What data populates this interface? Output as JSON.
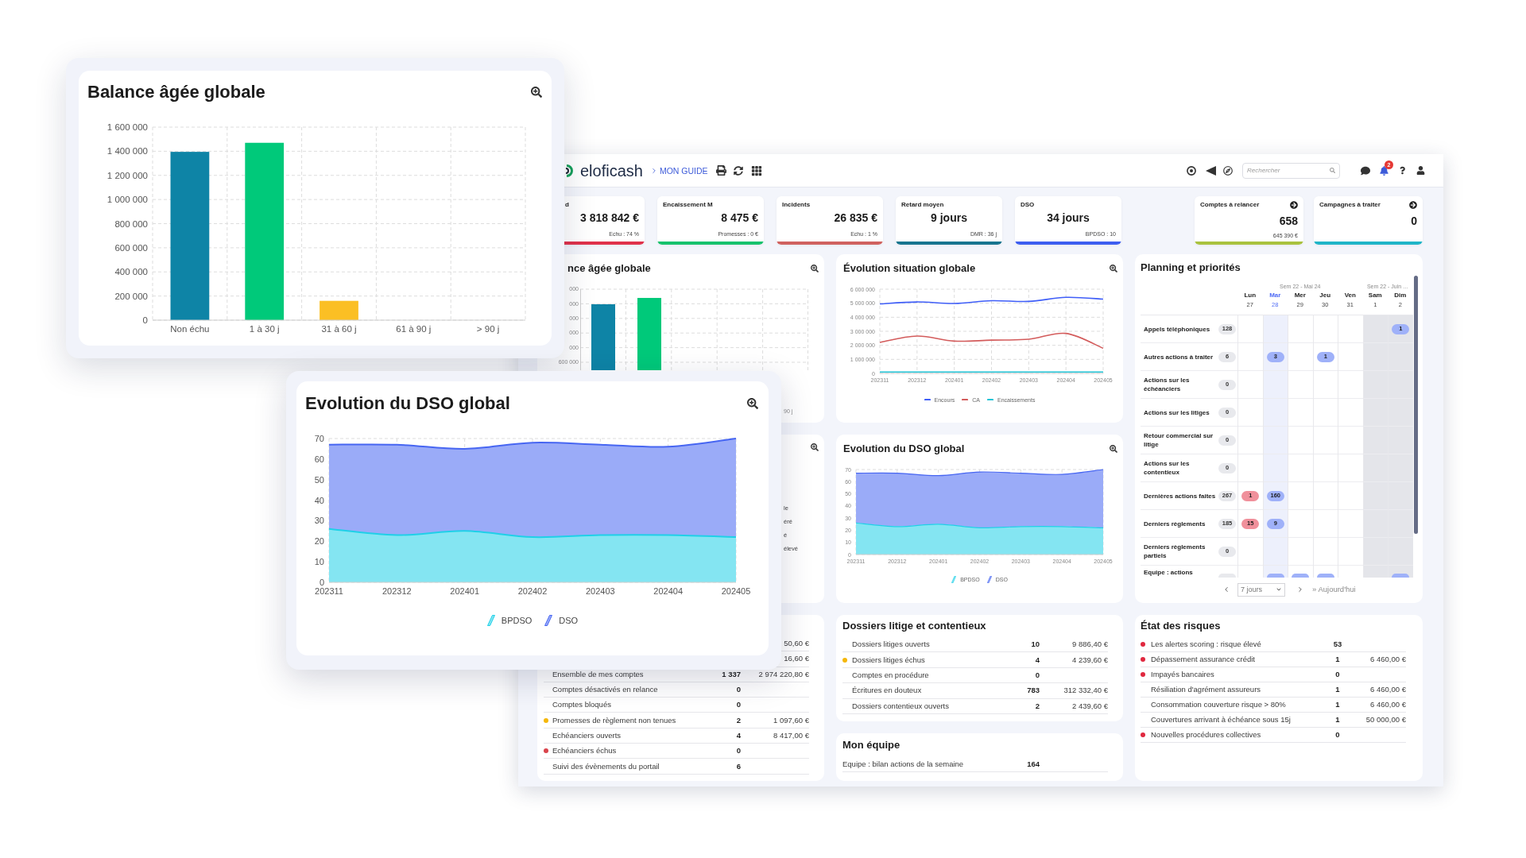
{
  "overlay_cards": [
    {
      "title": "Balance âgée globale",
      "chart_data": {
        "type": "bar",
        "categories": [
          "Non échu",
          "1 à 30 j",
          "31 à 60 j",
          "61 à 90 j",
          "> 90 j"
        ],
        "values": [
          1395000,
          1470000,
          160000,
          0,
          0
        ],
        "colors": [
          "#0e84a6",
          "#00c97a",
          "#fbbf24",
          null,
          null
        ],
        "grid": true,
        "ylim": [
          0,
          1600000
        ],
        "yticks": [
          {
            "value": 0,
            "label": "0"
          },
          {
            "value": 200000,
            "label": "200 000"
          },
          {
            "value": 400000,
            "label": "400 000"
          },
          {
            "value": 600000,
            "label": "600 000"
          },
          {
            "value": 800000,
            "label": "800 000"
          },
          {
            "value": 1000000,
            "label": "1 000 000"
          },
          {
            "value": 1200000,
            "label": "1 200 000"
          },
          {
            "value": 1400000,
            "label": "1 400 000"
          },
          {
            "value": 1600000,
            "label": "1 600 000"
          }
        ]
      }
    },
    {
      "title": "Evolution du DSO global",
      "chart_data": {
        "type": "area",
        "x": [
          "202311",
          "202312",
          "202401",
          "202402",
          "202403",
          "202404",
          "202405"
        ],
        "series": [
          {
            "name": "BPDSO",
            "color": "#1fd0e8",
            "values": [
              26,
              23,
              25,
              22,
              23,
              23,
              22
            ]
          },
          {
            "name": "DSO",
            "color": "#4766f2",
            "values": [
              67,
              67,
              65,
              68,
              67,
              66,
              70
            ]
          }
        ],
        "grid": true,
        "legend": "bottom",
        "ylim": [
          0,
          70
        ],
        "yticks": [
          0,
          10,
          20,
          30,
          40,
          50,
          60,
          70
        ]
      }
    }
  ],
  "dashboard": {
    "header": {
      "logo": "eloficash",
      "guide_link": "MON GUIDE",
      "search": {
        "placeholder": "Rechercher"
      },
      "notification_count": "2"
    },
    "kpis": [
      {
        "label": "d",
        "value": "3 818 842 €",
        "note": "Echu : 74 %",
        "kind": "amount",
        "color": "#e0324b"
      },
      {
        "label": "Encaissement M",
        "value": "8 475 €",
        "note": "Promesses : 0 €",
        "kind": "amount",
        "color": "#18c26d"
      },
      {
        "label": "Incidents",
        "value": "26 835 €",
        "note": "Echu : 1 %",
        "kind": "amount",
        "color": "#d0625f"
      },
      {
        "label": "Retard moyen",
        "value": "9 jours",
        "note": "DMR : 36 j",
        "kind": "duration",
        "color": "#18758f"
      },
      {
        "label": "DSO",
        "value": "34 jours",
        "note": "BPDSO : 10",
        "kind": "duration",
        "color": "#3d5ef0"
      },
      {
        "label": "Comptes à relancer",
        "value": "658",
        "note": "645 390 €",
        "kind": "counter",
        "color": "#a9c23f"
      },
      {
        "label": "Campagnes à traiter",
        "value": "0",
        "kind": "counter",
        "color": "#20b5c8"
      }
    ],
    "partial_balance_card": {
      "title": "nce âgée globale",
      "y_tick_fragments": [
        "000",
        "000",
        "000",
        "000",
        "000",
        "600 000"
      ],
      "x_label_fragment": "90 j"
    },
    "situation_card": {
      "title": "Évolution situation globale",
      "chart_data": {
        "type": "line",
        "x": [
          "202311",
          "202312",
          "202401",
          "202402",
          "202403",
          "202404",
          "202405"
        ],
        "series": [
          {
            "name": "Encours",
            "color": "#3f5ef8",
            "values": [
              4950000,
              5090000,
              4980000,
              5180000,
              5130000,
              5420000,
              5290000
            ]
          },
          {
            "name": "CA",
            "color": "#d35b5b",
            "values": [
              2210000,
              2660000,
              2300000,
              2370000,
              2430000,
              2850000,
              1790000
            ]
          },
          {
            "name": "Encaissements",
            "color": "#22c4d6",
            "values": [
              100000,
              100000,
              100000,
              100000,
              100000,
              100000,
              100000
            ]
          }
        ],
        "grid": true,
        "legend": "bottom",
        "ylim": [
          0,
          6000000
        ],
        "yticks": [
          {
            "value": 0,
            "label": "0"
          },
          {
            "value": 1000000,
            "label": "1 000 000"
          },
          {
            "value": 2000000,
            "label": "2 000 000"
          },
          {
            "value": 3000000,
            "label": "3 000 000"
          },
          {
            "value": 4000000,
            "label": "4 000 000"
          },
          {
            "value": 5000000,
            "label": "5 000 000"
          },
          {
            "value": 6000000,
            "label": "6 000 000"
          }
        ]
      }
    },
    "planning": {
      "title": "Planning et priorités",
      "weeks": [
        {
          "label": "Sem 22 - Mai 24",
          "days": [
            {
              "name": "Lun",
              "date": "27",
              "selected": false,
              "weekend": false
            },
            {
              "name": "Mar",
              "date": "28",
              "selected": true,
              "weekend": false
            },
            {
              "name": "Mer",
              "date": "29",
              "selected": false,
              "weekend": false
            },
            {
              "name": "Jeu",
              "date": "30",
              "selected": false,
              "weekend": false
            },
            {
              "name": "Ven",
              "date": "31",
              "selected": false,
              "weekend": false
            }
          ]
        },
        {
          "label": "Sem 22 - Juin …",
          "days": [
            {
              "name": "Sam",
              "date": "1",
              "selected": false,
              "weekend": true
            },
            {
              "name": "Dim",
              "date": "2",
              "selected": false,
              "weekend": true
            }
          ]
        }
      ],
      "rows": [
        {
          "label": "Appels téléphoniques",
          "count": "128",
          "cut_off": false,
          "cells": [
            {
              "kind": "empty"
            },
            {
              "kind": "empty"
            },
            {
              "kind": "empty"
            },
            {
              "kind": "empty"
            },
            {
              "kind": "empty"
            },
            {
              "kind": "empty"
            },
            {
              "kind": "pill",
              "text": "1",
              "color": "#9fb1f9"
            }
          ]
        },
        {
          "label": "Autres actions à traiter",
          "count": "6",
          "cut_off": false,
          "cells": [
            {
              "kind": "empty"
            },
            {
              "kind": "pill",
              "text": "3",
              "color": "#9fb1f9"
            },
            {
              "kind": "empty"
            },
            {
              "kind": "pill",
              "text": "1",
              "color": "#9fb1f9"
            },
            {
              "kind": "empty"
            },
            {
              "kind": "empty"
            },
            {
              "kind": "empty"
            }
          ]
        },
        {
          "label": "Actions sur les échéanciers",
          "count": "0",
          "cut_off": false,
          "cells": [
            {
              "kind": "empty"
            },
            {
              "kind": "empty"
            },
            {
              "kind": "empty"
            },
            {
              "kind": "empty"
            },
            {
              "kind": "empty"
            },
            {
              "kind": "empty"
            },
            {
              "kind": "empty"
            }
          ]
        },
        {
          "label": "Actions sur les litiges",
          "count": "0",
          "cut_off": false,
          "cells": [
            {
              "kind": "empty"
            },
            {
              "kind": "empty"
            },
            {
              "kind": "empty"
            },
            {
              "kind": "empty"
            },
            {
              "kind": "empty"
            },
            {
              "kind": "empty"
            },
            {
              "kind": "empty"
            }
          ]
        },
        {
          "label": "Retour commercial sur litige",
          "count": "0",
          "cut_off": false,
          "cells": [
            {
              "kind": "empty"
            },
            {
              "kind": "empty"
            },
            {
              "kind": "empty"
            },
            {
              "kind": "empty"
            },
            {
              "kind": "empty"
            },
            {
              "kind": "empty"
            },
            {
              "kind": "empty"
            }
          ]
        },
        {
          "label": "Actions sur les contentieux",
          "count": "0",
          "cut_off": false,
          "cells": [
            {
              "kind": "empty"
            },
            {
              "kind": "empty"
            },
            {
              "kind": "empty"
            },
            {
              "kind": "empty"
            },
            {
              "kind": "empty"
            },
            {
              "kind": "empty"
            },
            {
              "kind": "empty"
            }
          ]
        },
        {
          "label": "Dernières actions faites",
          "count": "267",
          "cut_off": false,
          "cells": [
            {
              "kind": "pill",
              "text": "1",
              "color": "#f0909b"
            },
            {
              "kind": "pill",
              "text": "160",
              "color": "#9fb1f9"
            },
            {
              "kind": "empty"
            },
            {
              "kind": "empty"
            },
            {
              "kind": "empty"
            },
            {
              "kind": "empty"
            },
            {
              "kind": "empty"
            }
          ]
        },
        {
          "label": "Derniers règlements",
          "count": "185",
          "cut_off": false,
          "cells": [
            {
              "kind": "pill",
              "text": "15",
              "color": "#f0909b"
            },
            {
              "kind": "pill",
              "text": "9",
              "color": "#9fb1f9"
            },
            {
              "kind": "empty"
            },
            {
              "kind": "empty"
            },
            {
              "kind": "empty"
            },
            {
              "kind": "empty"
            },
            {
              "kind": "empty"
            }
          ]
        },
        {
          "label": "Derniers règlements partiels",
          "count": "0",
          "cut_off": false,
          "cells": [
            {
              "kind": "empty"
            },
            {
              "kind": "empty"
            },
            {
              "kind": "empty"
            },
            {
              "kind": "empty"
            },
            {
              "kind": "empty"
            },
            {
              "kind": "empty"
            },
            {
              "kind": "empty"
            }
          ]
        },
        {
          "label": "Equipe : actions",
          "cut_off": true,
          "cells": [
            {
              "kind": "empty"
            },
            {
              "kind": "pill",
              "color": "#9fb1f9"
            },
            {
              "kind": "pill",
              "color": "#9fb1f9"
            },
            {
              "kind": "pill",
              "color": "#9fb1f9"
            },
            {
              "kind": "empty"
            },
            {
              "kind": "empty"
            },
            {
              "kind": "pill",
              "color": "#9fb1f9"
            }
          ]
        }
      ],
      "footer": {
        "period": "7 jours",
        "today_link": "» Aujourd'hui"
      }
    },
    "partial_card": {
      "text_fragments": [
        "le",
        "éré",
        "é",
        "élevé"
      ]
    },
    "dso_card": {
      "title": "Evolution du DSO global",
      "chart_data": {
        "type": "area",
        "x": [
          "202311",
          "202312",
          "202401",
          "202402",
          "202403",
          "202404",
          "202405"
        ],
        "series": [
          {
            "name": "BPDSO",
            "color": "#1fd0e8",
            "values": [
              26,
              23,
              25,
              22,
              23,
              23,
              22
            ]
          },
          {
            "name": "DSO",
            "color": "#4766f2",
            "values": [
              67,
              67,
              65,
              68,
              67,
              66,
              70
            ]
          }
        ],
        "grid": true,
        "legend": "bottom",
        "ylim": [
          0,
          70
        ],
        "yticks": [
          0,
          10,
          20,
          30,
          40,
          50,
          60,
          70
        ]
      }
    },
    "accounts_card": {
      "rows": [
        {
          "amount": "50,60 €"
        },
        {
          "amount": "16,60 €"
        },
        {
          "label": "Ensemble de mes comptes",
          "count": "1 337",
          "amount": "2 974 220,80 €"
        },
        {
          "label": "Comptes désactivés en relance",
          "count": "0"
        },
        {
          "label": "Comptes bloqués",
          "count": "0"
        },
        {
          "label": "Promesses de règlement non tenues",
          "count": "2",
          "amount": "1 097,60 €",
          "color": "#f5b70a"
        },
        {
          "label": "Echéanciers ouverts",
          "count": "4",
          "amount": "8 417,00 €"
        },
        {
          "label": "Echéanciers échus",
          "count": "0",
          "color": "#d9434b"
        },
        {
          "label": "Suivi des évènements du portail",
          "count": "6"
        }
      ]
    },
    "disputes_card": {
      "title": "Dossiers litige et contentieux",
      "rows": [
        {
          "label": "Dossiers litiges ouverts",
          "count": "10",
          "amount": "9 886,40 €"
        },
        {
          "label": "Dossiers litiges échus",
          "count": "4",
          "amount": "4 239,60 €",
          "color": "#f5b70a"
        },
        {
          "label": "Comptes en procédure",
          "count": "0"
        },
        {
          "label": "Écritures en douteux",
          "count": "783",
          "amount": "312 332,40 €"
        },
        {
          "label": "Dossiers contentieux ouverts",
          "count": "2",
          "amount": "2 439,60 €"
        }
      ]
    },
    "team_card": {
      "title": "Mon équipe",
      "rows": [
        {
          "label": "Equipe : bilan actions de la semaine",
          "count": "164"
        }
      ]
    },
    "risks_card": {
      "title": "État des risques",
      "rows": [
        {
          "label": "Les alertes scoring : risque élevé",
          "count": "53",
          "color": "#e0283f"
        },
        {
          "label": "Dépassement assurance crédit",
          "count": "1",
          "amount": "6 460,00 €",
          "color": "#e0283f"
        },
        {
          "label": "Impayés bancaires",
          "count": "0",
          "color": "#e0283f"
        },
        {
          "label": "Résiliation d'agrément assureurs",
          "count": "1",
          "amount": "6 460,00 €"
        },
        {
          "label": "Consommation couverture risque > 80%",
          "count": "1",
          "amount": "6 460,00 €"
        },
        {
          "label": "Couvertures arrivant à échéance sous 15j",
          "count": "1",
          "amount": "50 000,00 €"
        },
        {
          "label": "Nouvelles procédures collectives",
          "count": "0",
          "color": "#e0283f"
        }
      ]
    }
  }
}
